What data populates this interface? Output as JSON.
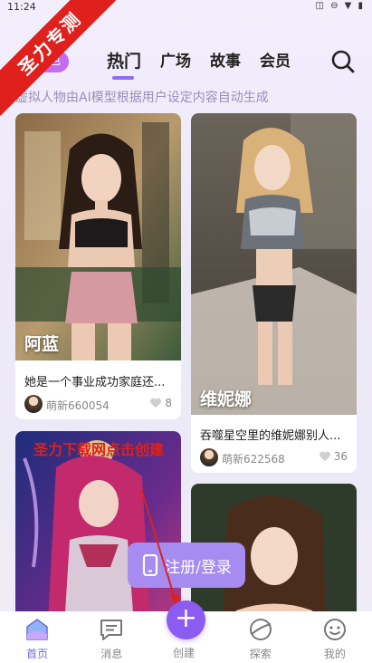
{
  "status_bar": {
    "time": "11:24",
    "icons": "◫ ⊖ ▼ ▮"
  },
  "ribbon": {
    "text": "圣力专测"
  },
  "header": {
    "role_chip": "角色",
    "tabs": [
      {
        "label": "热门",
        "active": true
      },
      {
        "label": "广场",
        "active": false
      },
      {
        "label": "故事",
        "active": false
      },
      {
        "label": "会员",
        "active": false
      }
    ],
    "search_icon": "search-icon"
  },
  "subtitle": "虚拟人物由AI模型根据用户设定内容自动生成",
  "cards": [
    {
      "name": "阿蓝",
      "desc": "她是一个事业成功家庭还...",
      "user": "萌新660054",
      "likes": "8"
    },
    {
      "name": "维妮娜",
      "desc": "吞噬星空里的维妮娜别人...",
      "user": "萌新622568",
      "likes": "36"
    },
    {
      "name": "",
      "desc": "",
      "user": "",
      "likes": ""
    },
    {
      "name": "",
      "desc": "",
      "user": "",
      "likes": ""
    }
  ],
  "overlay_text": "圣力下载网点击创建",
  "register_button": "注册/登录",
  "bottom_nav": {
    "items": [
      {
        "label": "首页",
        "icon": "home-icon",
        "active": true
      },
      {
        "label": "消息",
        "icon": "message-icon",
        "active": false
      },
      {
        "label": "创建",
        "icon": "plus-icon",
        "active": false
      },
      {
        "label": "探索",
        "icon": "explore-icon",
        "active": false
      },
      {
        "label": "我的",
        "icon": "profile-icon",
        "active": false
      }
    ]
  },
  "colors": {
    "accent": "#8c5bf1",
    "tab_indicator": "#8f6cf5",
    "ribbon": "#e0201c",
    "register_button": "#a68bf0"
  }
}
